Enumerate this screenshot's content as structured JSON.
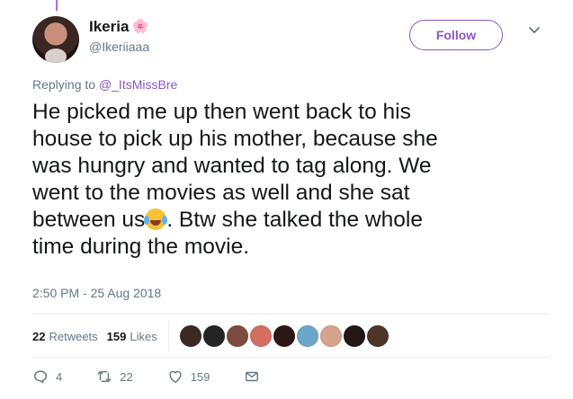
{
  "tweet": {
    "display_name": "Ikeria",
    "name_emoji": "🌸",
    "handle": "@Ikeriiaaa",
    "follow_label": "Follow",
    "replying_prefix": "Replying to ",
    "replying_to": "@_ItsMissBre",
    "text_before_emoji": "He picked me up then went back to his\nhouse to pick up his mother, because she\nwas hungry and wanted to tag along. We\nwent to the movies as well and she sat\nbetween us",
    "text_after_emoji": ". Btw she talked the whole\ntime during the movie.",
    "timestamp": "2:50 PM - 25 Aug 2018"
  },
  "stats": {
    "retweets_count": "22",
    "retweets_label": "Retweets",
    "likes_count": "159",
    "likes_label": "Likes",
    "liker_avatar_colors": [
      "#3b2a24",
      "#242424",
      "#7c4b3d",
      "#d36e62",
      "#2d1716",
      "#6aa7c8",
      "#d5a28a",
      "#221714",
      "#4d3527"
    ]
  },
  "actions": {
    "replies_count": "4",
    "retweets_count": "22",
    "likes_count": "159"
  },
  "colors": {
    "accent": "#8c54c8",
    "thread_line": "#b66bd6",
    "text_primary": "#14171a",
    "text_secondary": "#657786",
    "border": "#e6ecf0"
  }
}
